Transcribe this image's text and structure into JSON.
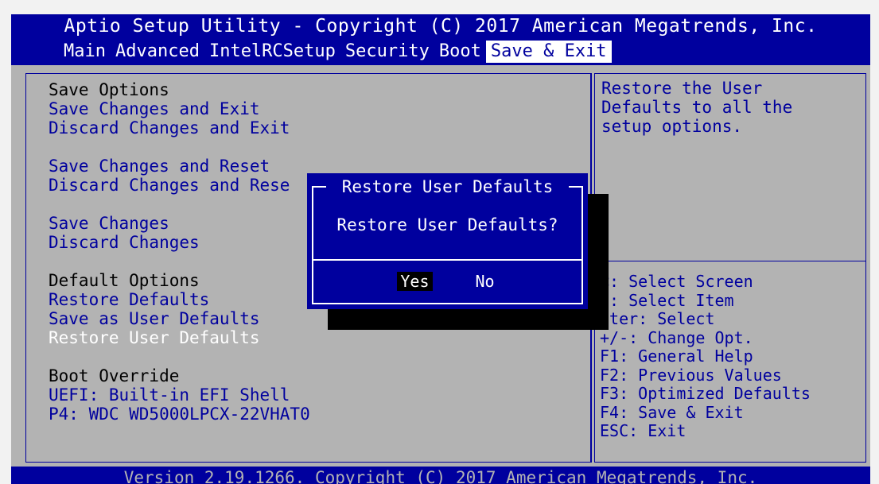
{
  "header": {
    "title": "Aptio Setup Utility - Copyright (C) 2017 American Megatrends, Inc.",
    "tabs": [
      "Main",
      "Advanced",
      "IntelRCSetup",
      "Security",
      "Boot",
      "Save & Exit"
    ],
    "active_tab": "Save & Exit"
  },
  "options": {
    "save_options_label": "Save Options",
    "save_changes_and_exit": "Save Changes and Exit",
    "discard_changes_and_exit": "Discard Changes and Exit",
    "save_changes_and_reset": "Save Changes and Reset",
    "discard_changes_and_reset": "Discard Changes and Rese",
    "save_changes": "Save Changes",
    "discard_changes": "Discard Changes",
    "default_options_label": "Default Options",
    "restore_defaults": "Restore Defaults",
    "save_as_user_defaults": "Save as User Defaults",
    "restore_user_defaults": "Restore User Defaults",
    "boot_override_label": "Boot Override",
    "boot_uefi_shell": "UEFI: Built-in EFI Shell",
    "boot_p4": "P4: WDC WD5000LPCX-22VHAT0"
  },
  "help": {
    "description": "Restore the User\nDefaults to all the\nsetup options.",
    "keys": [
      "<: Select Screen",
      "↓: Select Item",
      "nter: Select",
      "+/-: Change Opt.",
      "F1: General Help",
      "F2: Previous Values",
      "F3: Optimized Defaults",
      "F4: Save & Exit",
      "ESC: Exit"
    ]
  },
  "dialog": {
    "title": "Restore User Defaults",
    "question": "Restore User Defaults?",
    "yes_label": "Yes",
    "no_label": "No",
    "selected": "Yes"
  },
  "footer": {
    "text": "Version 2.19.1266. Copyright (C) 2017 American Megatrends, Inc."
  },
  "colors": {
    "bios_blue": "#00009e",
    "panel_gray": "#b3b3b3",
    "highlight_white": "#ffffff"
  }
}
